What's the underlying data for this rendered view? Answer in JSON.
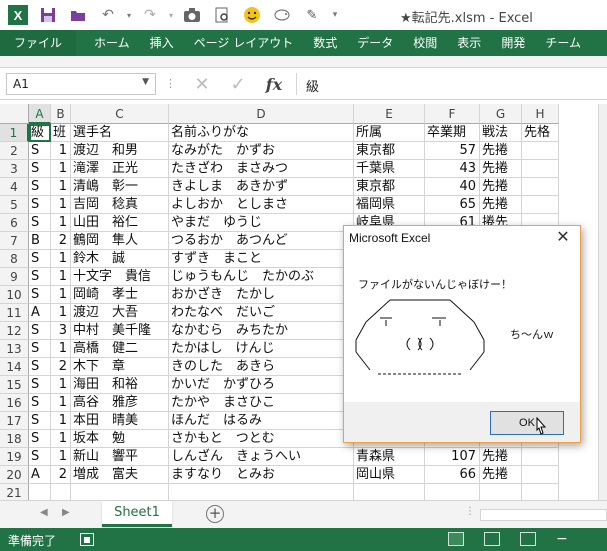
{
  "window": {
    "title": "★転記先.xlsm - Excel"
  },
  "qat": {
    "icons": [
      "excel-logo",
      "save-icon",
      "open-icon",
      "undo-icon",
      "redo-icon",
      "camera-icon",
      "print-preview-icon",
      "smiley-icon",
      "piggy-icon",
      "pin-icon",
      "customize-icon"
    ]
  },
  "ribbon": {
    "tabs": [
      "ファイル",
      "ホーム",
      "挿入",
      "ページ レイアウト",
      "数式",
      "データ",
      "校閲",
      "表示",
      "開発",
      "チーム"
    ]
  },
  "formula_bar": {
    "name_box": "A1",
    "content": "級"
  },
  "columns": [
    "A",
    "B",
    "C",
    "D",
    "E",
    "F",
    "G",
    "H"
  ],
  "rows": [
    [
      "級",
      "班",
      "選手名",
      "名前ふりがな",
      "所属",
      "卒業期",
      "戦法",
      "先格"
    ],
    [
      "S",
      "1",
      "渡辺　和男",
      "なみがた　かずお",
      "東京都",
      "57",
      "先捲",
      ""
    ],
    [
      "S",
      "1",
      "滝澤　正光",
      "たきざわ　まさみつ",
      "千葉県",
      "43",
      "先捲",
      ""
    ],
    [
      "S",
      "1",
      "清嶋　彰一",
      "きよしま　あきかず",
      "東京都",
      "40",
      "先捲",
      ""
    ],
    [
      "S",
      "1",
      "吉岡　稔真",
      "よしおか　としまさ",
      "福岡県",
      "65",
      "先捲",
      ""
    ],
    [
      "S",
      "1",
      "山田　裕仁",
      "やまだ　ゆうじ",
      "岐阜県",
      "61",
      "捲先",
      ""
    ],
    [
      "B",
      "2",
      "鶴岡　隼人",
      "つるおか　あつんど",
      "",
      "",
      "",
      ""
    ],
    [
      "S",
      "1",
      "鈴木　誠",
      "すずき　まこと",
      "",
      "",
      "",
      ""
    ],
    [
      "S",
      "1",
      "十文字　貴信",
      "じゅうもんじ　たかのぶ",
      "",
      "",
      "",
      ""
    ],
    [
      "S",
      "1",
      "岡崎　孝士",
      "おかざき　たかし",
      "",
      "",
      "",
      ""
    ],
    [
      "A",
      "1",
      "渡辺　大吾",
      "わたなべ　だいご",
      "",
      "",
      "",
      ""
    ],
    [
      "S",
      "3",
      "中村　美千隆",
      "なかむら　みちたか",
      "",
      "",
      "",
      ""
    ],
    [
      "S",
      "1",
      "高橋　健二",
      "たかはし　けんじ",
      "",
      "",
      "",
      ""
    ],
    [
      "S",
      "2",
      "木下　章",
      "きのした　あきら",
      "",
      "",
      "",
      ""
    ],
    [
      "S",
      "1",
      "海田　和裕",
      "かいだ　かずひろ",
      "",
      "",
      "",
      ""
    ],
    [
      "S",
      "1",
      "高谷　雅彦",
      "たかや　まさひこ",
      "",
      "",
      "",
      ""
    ],
    [
      "S",
      "1",
      "本田　晴美",
      "ほんだ　はるみ",
      "",
      "",
      "",
      ""
    ],
    [
      "S",
      "1",
      "坂本　勉",
      "さかもと　つとむ",
      "",
      "",
      "",
      ""
    ],
    [
      "S",
      "1",
      "新山　響平",
      "しんざん　きょうへい",
      "青森県",
      "107",
      "先捲",
      ""
    ],
    [
      "A",
      "2",
      "増成　富夫",
      "ますなり　とみお",
      "岡山県",
      "66",
      "先捲",
      ""
    ],
    [
      "",
      "",
      "",
      "",
      "",
      "",
      "",
      ""
    ]
  ],
  "sheet_tabs": [
    "Sheet1"
  ],
  "status": {
    "ready": "準備完了"
  },
  "dialog": {
    "title": "Microsoft Excel",
    "close": "✕",
    "message": "ファイルがないんじゃぼけー！",
    "side_text": "ち～んｗ",
    "ok_label": "OK",
    "ascii_art": [
      "＿＿＿＿",
      "／　　　　　＼",
      "／　─　　　─　＼",
      "｜　　（　）（　）　｜",
      "＼　　　　　　　／",
      "＼＿＿＿＿／"
    ]
  },
  "colors": {
    "excel_green": "#217346",
    "dialog_border": "#f0a040",
    "ok_border": "#2a6fba"
  }
}
